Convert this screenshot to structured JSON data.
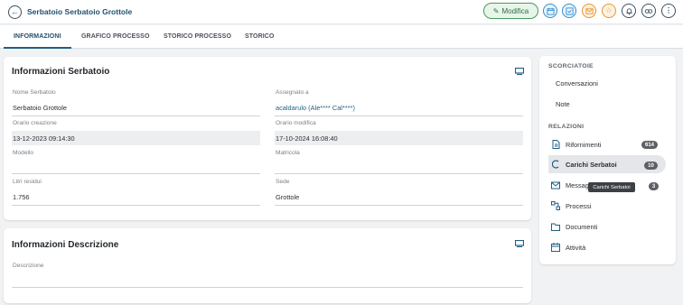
{
  "header": {
    "title": "Serbatoio Serbatoio Grottole",
    "edit_label": "Modifica",
    "icons": [
      "back-icon",
      "calendar-icon",
      "checklist-icon",
      "mail-icon",
      "star-icon",
      "bell-icon",
      "link-icon",
      "more-icon"
    ]
  },
  "tabs": [
    {
      "label": "INFORMAZIONI",
      "active": true
    },
    {
      "label": "GRAFICO PROCESSO",
      "active": false
    },
    {
      "label": "STORICO PROCESSO",
      "active": false
    },
    {
      "label": "STORICO",
      "active": false
    }
  ],
  "info_card": {
    "title": "Informazioni Serbatoio",
    "fields": {
      "nome": {
        "label": "Nome Serbatoio",
        "value": "Serbatoio Grottole"
      },
      "assegnato": {
        "label": "Assegnato a",
        "value": "acaldarulo (Ale**** Cal****)"
      },
      "creazione": {
        "label": "Orario creazione",
        "value": "13-12-2023 09:14:30"
      },
      "modifica": {
        "label": "Orario modifica",
        "value": "17-10-2024 16:08:40"
      },
      "modello": {
        "label": "Modello",
        "value": ""
      },
      "matricola": {
        "label": "Matricola",
        "value": ""
      },
      "litri": {
        "label": "Litri residui",
        "value": "1.756"
      },
      "sede": {
        "label": "Sede",
        "value": "Grottole"
      }
    }
  },
  "desc_card": {
    "title": "Informazioni Descrizione",
    "field_label": "Descrizione",
    "field_value": ""
  },
  "sidebar": {
    "shortcuts_heading": "SCORCIATOIE",
    "shortcuts": [
      "Conversazioni",
      "Note"
    ],
    "relations_heading": "RELAZIONI",
    "relations": [
      {
        "label": "Rifornimenti",
        "count": "614"
      },
      {
        "label": "Carichi Serbatoi",
        "count": "10"
      },
      {
        "label": "Messaggi",
        "count": "3"
      },
      {
        "label": "Processi",
        "count": ""
      },
      {
        "label": "Documenti",
        "count": ""
      },
      {
        "label": "Attività",
        "count": ""
      }
    ],
    "tooltip": "Carichi Serbatoi"
  },
  "colors": {
    "accent": "#1f5f86",
    "edit_green": "#4a9a5c",
    "icon_blue": "#2f8fd0",
    "icon_orange": "#e8952e"
  }
}
